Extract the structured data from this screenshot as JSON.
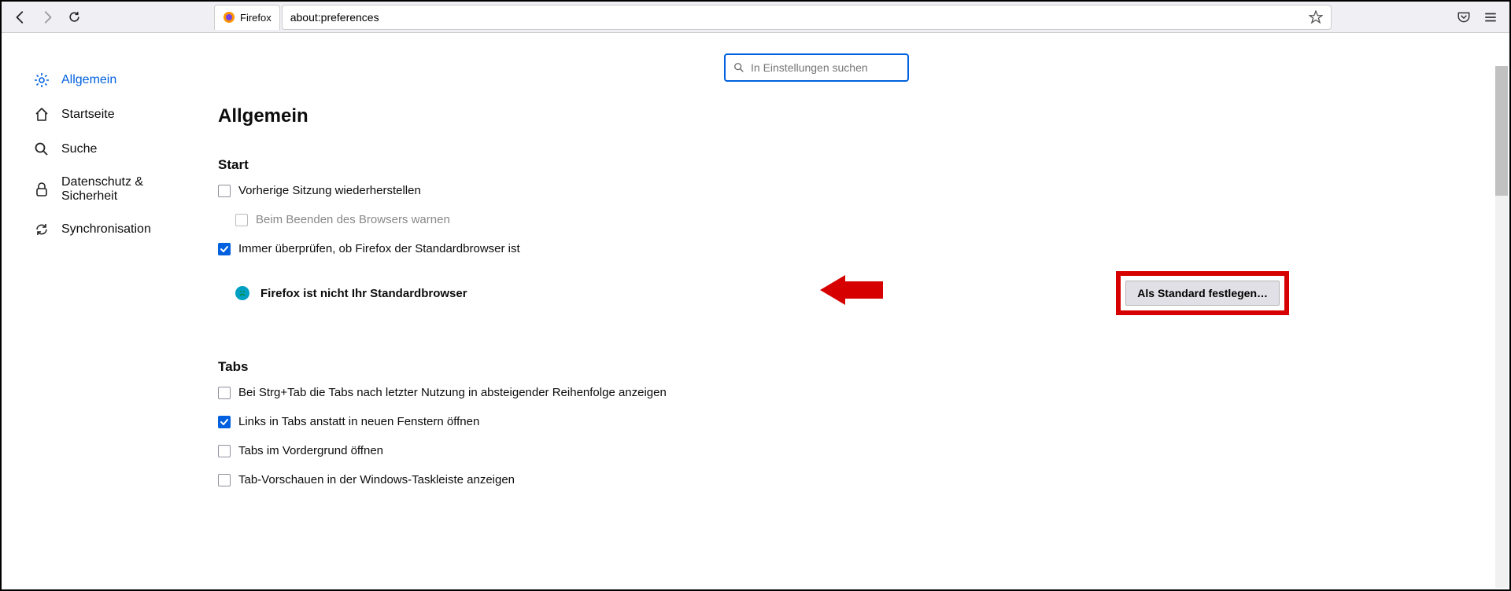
{
  "toolbar": {
    "tab_label": "Firefox",
    "url": "about:preferences"
  },
  "search": {
    "placeholder": "In Einstellungen suchen"
  },
  "sidebar": {
    "items": [
      {
        "label": "Allgemein",
        "active": true
      },
      {
        "label": "Startseite",
        "active": false
      },
      {
        "label": "Suche",
        "active": false
      },
      {
        "label": "Datenschutz & Sicherheit",
        "active": false
      },
      {
        "label": "Synchronisation",
        "active": false
      }
    ]
  },
  "page": {
    "title": "Allgemein",
    "start": {
      "heading": "Start",
      "restore_prev": "Vorherige Sitzung wiederherstellen",
      "warn_on_close": "Beim Beenden des Browsers warnen",
      "always_check": "Immer überprüfen, ob Firefox der Standardbrowser ist",
      "not_default": "Firefox ist nicht Ihr Standardbrowser",
      "set_default_btn": "Als Standard festlegen…"
    },
    "tabs": {
      "heading": "Tabs",
      "ctrl_tab": "Bei Strg+Tab die Tabs nach letzter Nutzung in absteigender Reihenfolge anzeigen",
      "open_in_tabs": "Links in Tabs anstatt in neuen Fenstern öffnen",
      "foreground": "Tabs im Vordergrund öffnen",
      "taskbar_preview": "Tab-Vorschauen in der Windows-Taskleiste anzeigen"
    }
  }
}
